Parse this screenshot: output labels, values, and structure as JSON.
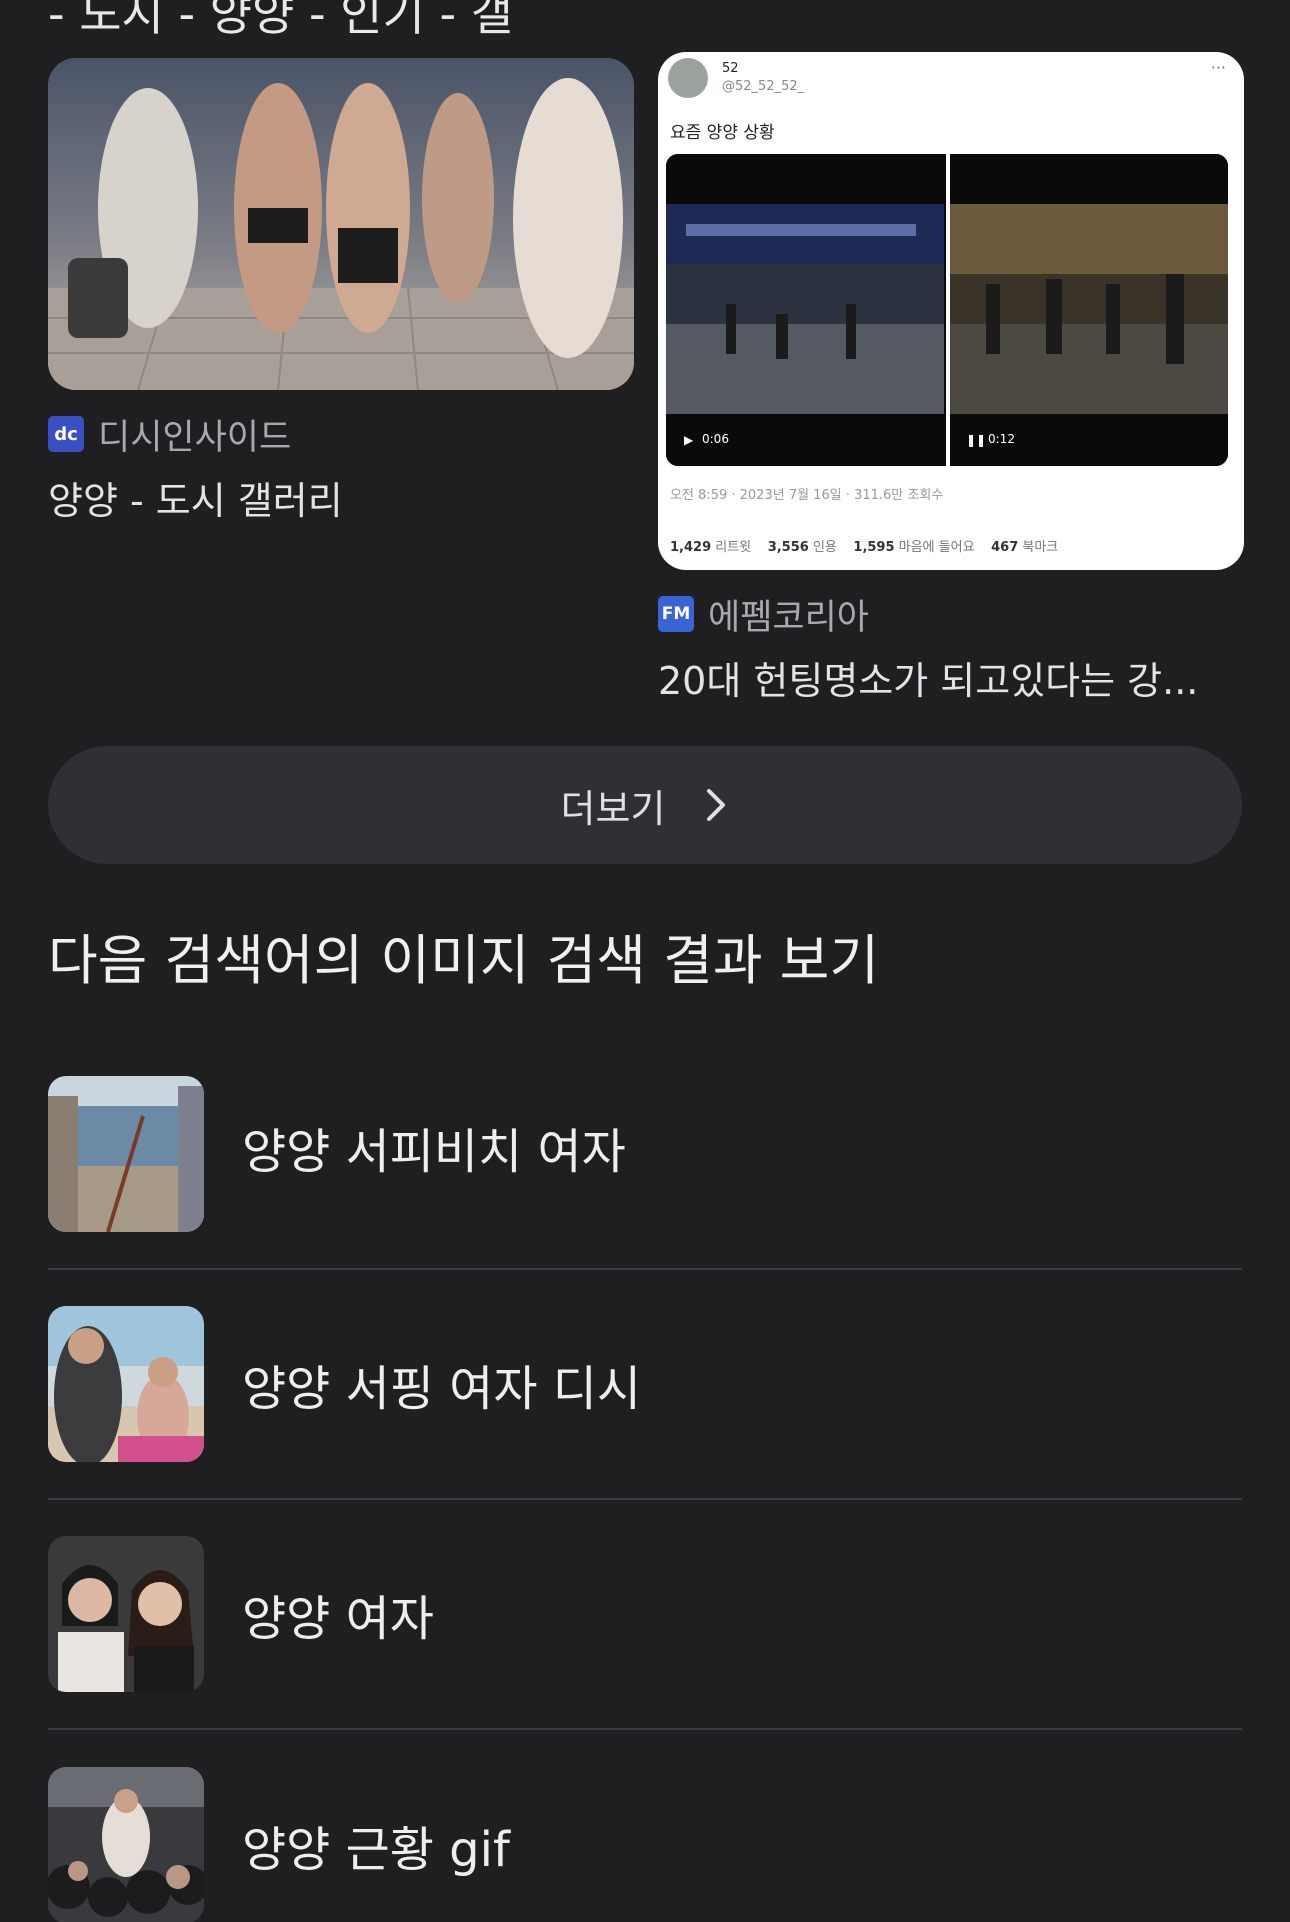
{
  "cut_heading": "- 도시 - 양양 - 인기 - 갤",
  "cards": [
    {
      "source": "디시인사이드",
      "source_badge": "dc",
      "title": "양양 - 도시 갤러리"
    },
    {
      "source": "에펨코리아",
      "source_badge": "FM",
      "title": "20대 헌팅명소가 되고있다는 강...",
      "tweet": {
        "name": "52",
        "handle": "@52_52_52_",
        "text": "요즘 양양 상황",
        "video_left_time": "0:06",
        "video_right_time": "0:12",
        "meta": "오전 8:59 · 2023년 7월 16일 · 311.6만 조회수",
        "stats": [
          "1,429",
          "리트윗",
          "3,556",
          "인용",
          "1,595",
          "마음에 들어요",
          "467",
          "북마크"
        ]
      }
    }
  ],
  "more_button": {
    "label": "더보기"
  },
  "section_title": "다음 검색어의 이미지 검색 결과 보기",
  "related": [
    {
      "label": "양양 서피비치 여자"
    },
    {
      "label": "양양 서핑 여자 디시"
    },
    {
      "label": "양양 여자"
    },
    {
      "label": "양양 근황 gif"
    }
  ],
  "colors": {
    "background": "#1f1f21",
    "button_bg": "#2f3033",
    "divider": "#3a3b3e"
  }
}
